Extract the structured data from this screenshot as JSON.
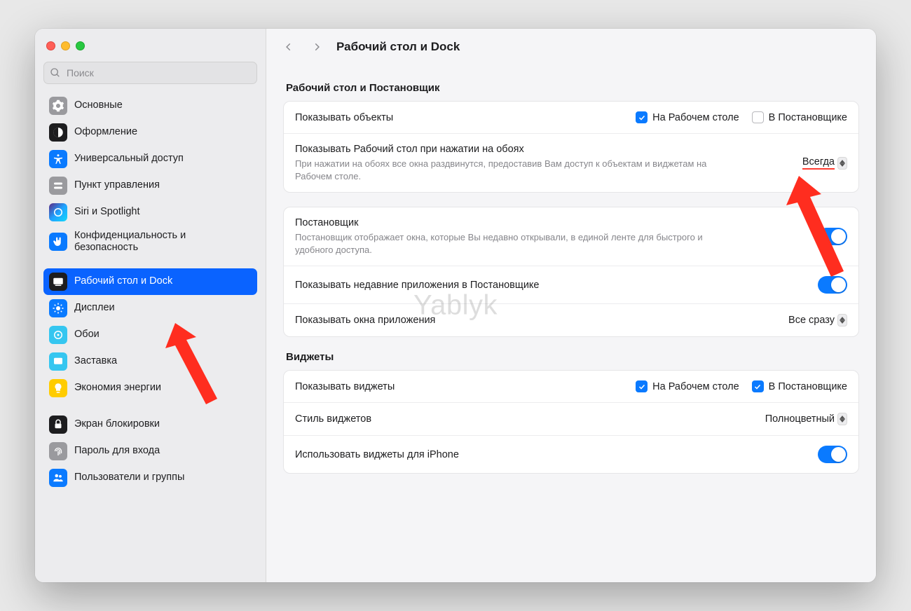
{
  "search": {
    "placeholder": "Поиск"
  },
  "sidebar": {
    "items": [
      {
        "key": "general",
        "label": "Основные"
      },
      {
        "key": "appearance",
        "label": "Оформление"
      },
      {
        "key": "accessibility",
        "label": "Универсальный доступ"
      },
      {
        "key": "control-center",
        "label": "Пункт управления"
      },
      {
        "key": "siri",
        "label": "Siri и Spotlight"
      },
      {
        "key": "privacy",
        "label": "Конфиденциальность и безопасность"
      },
      {
        "key": "desktop-dock",
        "label": "Рабочий стол и Dock"
      },
      {
        "key": "displays",
        "label": "Дисплеи"
      },
      {
        "key": "wallpaper",
        "label": "Обои"
      },
      {
        "key": "screensaver",
        "label": "Заставка"
      },
      {
        "key": "energy",
        "label": "Экономия энергии"
      },
      {
        "key": "lock-screen",
        "label": "Экран блокировки"
      },
      {
        "key": "password",
        "label": "Пароль для входа"
      },
      {
        "key": "users",
        "label": "Пользователи и группы"
      }
    ]
  },
  "header": {
    "title": "Рабочий стол и Dock"
  },
  "sections": {
    "desktop_stage": {
      "title": "Рабочий стол и Постановщик",
      "show_items": {
        "label": "Показывать объекты",
        "opt_desktop": "На Рабочем столе",
        "opt_stage": "В Постановщике",
        "desktop_checked": true,
        "stage_checked": false
      },
      "click_wallpaper": {
        "label": "Показывать Рабочий стол при нажатии на обоях",
        "desc": "При нажатии на обоях все окна раздвинутся, предоставив Вам доступ к объектам и виджетам на Рабочем столе.",
        "value": "Всегда"
      }
    },
    "stage_manager": {
      "title": "Постановщик",
      "desc": "Постановщик отображает окна, которые Вы недавно открывали, в единой ленте для быстрого и удобного доступа.",
      "enabled": true,
      "recent_apps": {
        "label": "Показывать недавние приложения в Постановщике",
        "enabled": true
      },
      "show_windows": {
        "label": "Показывать окна приложения",
        "value": "Все сразу"
      }
    },
    "widgets": {
      "title": "Виджеты",
      "show_widgets": {
        "label": "Показывать виджеты",
        "opt_desktop": "На Рабочем столе",
        "opt_stage": "В Постановщике",
        "desktop_checked": true,
        "stage_checked": true
      },
      "style": {
        "label": "Стиль виджетов",
        "value": "Полноцветный"
      },
      "iphone": {
        "label": "Использовать виджеты для iPhone",
        "enabled": true
      }
    }
  },
  "watermark": "Yablyk"
}
